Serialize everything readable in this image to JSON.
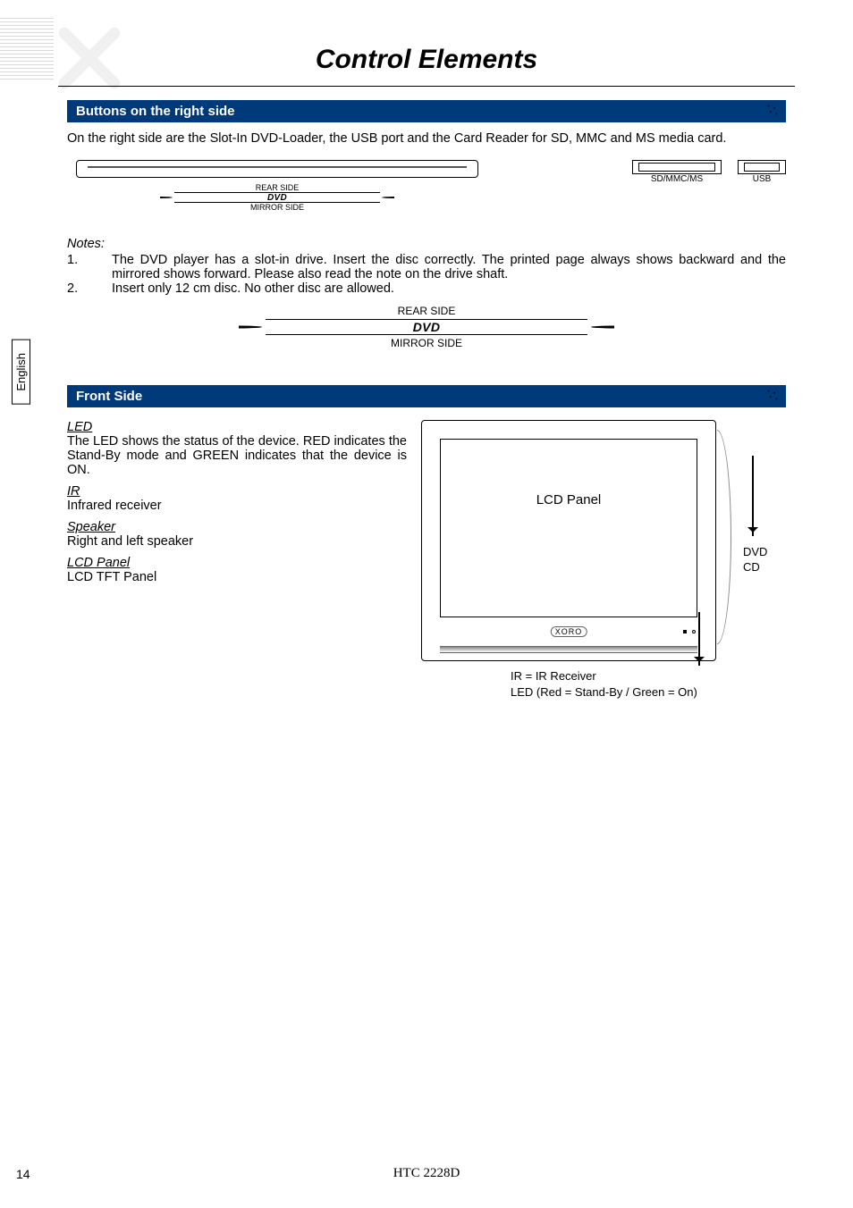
{
  "page": {
    "title": "Control Elements",
    "model": "HTC 2228D",
    "number": "14",
    "language_tab": "English"
  },
  "section_right": {
    "heading": "Buttons on the right side",
    "intro": "On the right side are the Slot-In DVD-Loader, the USB port and the Card Reader for SD, MMC and MS media card.",
    "rear_side_small": "REAR SIDE",
    "dvd_logo_small": "DVD",
    "mirror_side_small": "MIRROR SIDE",
    "port_sdmmc": "SD/MMC/MS",
    "port_usb": "USB",
    "notes_label": "Notes:",
    "note1_num": "1.",
    "note1": "The DVD player has a slot-in drive. Insert the disc correctly. The printed page always shows backward and the mirrored shows forward. Please also read the note on the drive shaft.",
    "note2_num": "2.",
    "note2": "Insert only 12 cm disc. No other disc are allowed.",
    "rear_side_large": "REAR SIDE",
    "dvd_logo_large": "DVD",
    "mirror_side_large": "MIRROR SIDE"
  },
  "section_front": {
    "heading": "Front Side",
    "led_h": "LED",
    "led_p": "The LED shows the status of the device. RED indicates the Stand-By mode and GREEN indicates that the device is ON.",
    "ir_h": "IR",
    "ir_p": "Infrared receiver",
    "speaker_h": "Speaker",
    "speaker_p": "Right and left speaker",
    "lcd_h": "LCD Panel",
    "lcd_p": "LCD TFT Panel",
    "diagram": {
      "lcd_label": "LCD Panel",
      "brand": "XORO",
      "dvd_cd_label_line1": "DVD",
      "dvd_cd_label_line2": "CD",
      "ir_line": "IR = IR Receiver",
      "led_line": "LED (Red = Stand-By / Green = On)"
    }
  }
}
